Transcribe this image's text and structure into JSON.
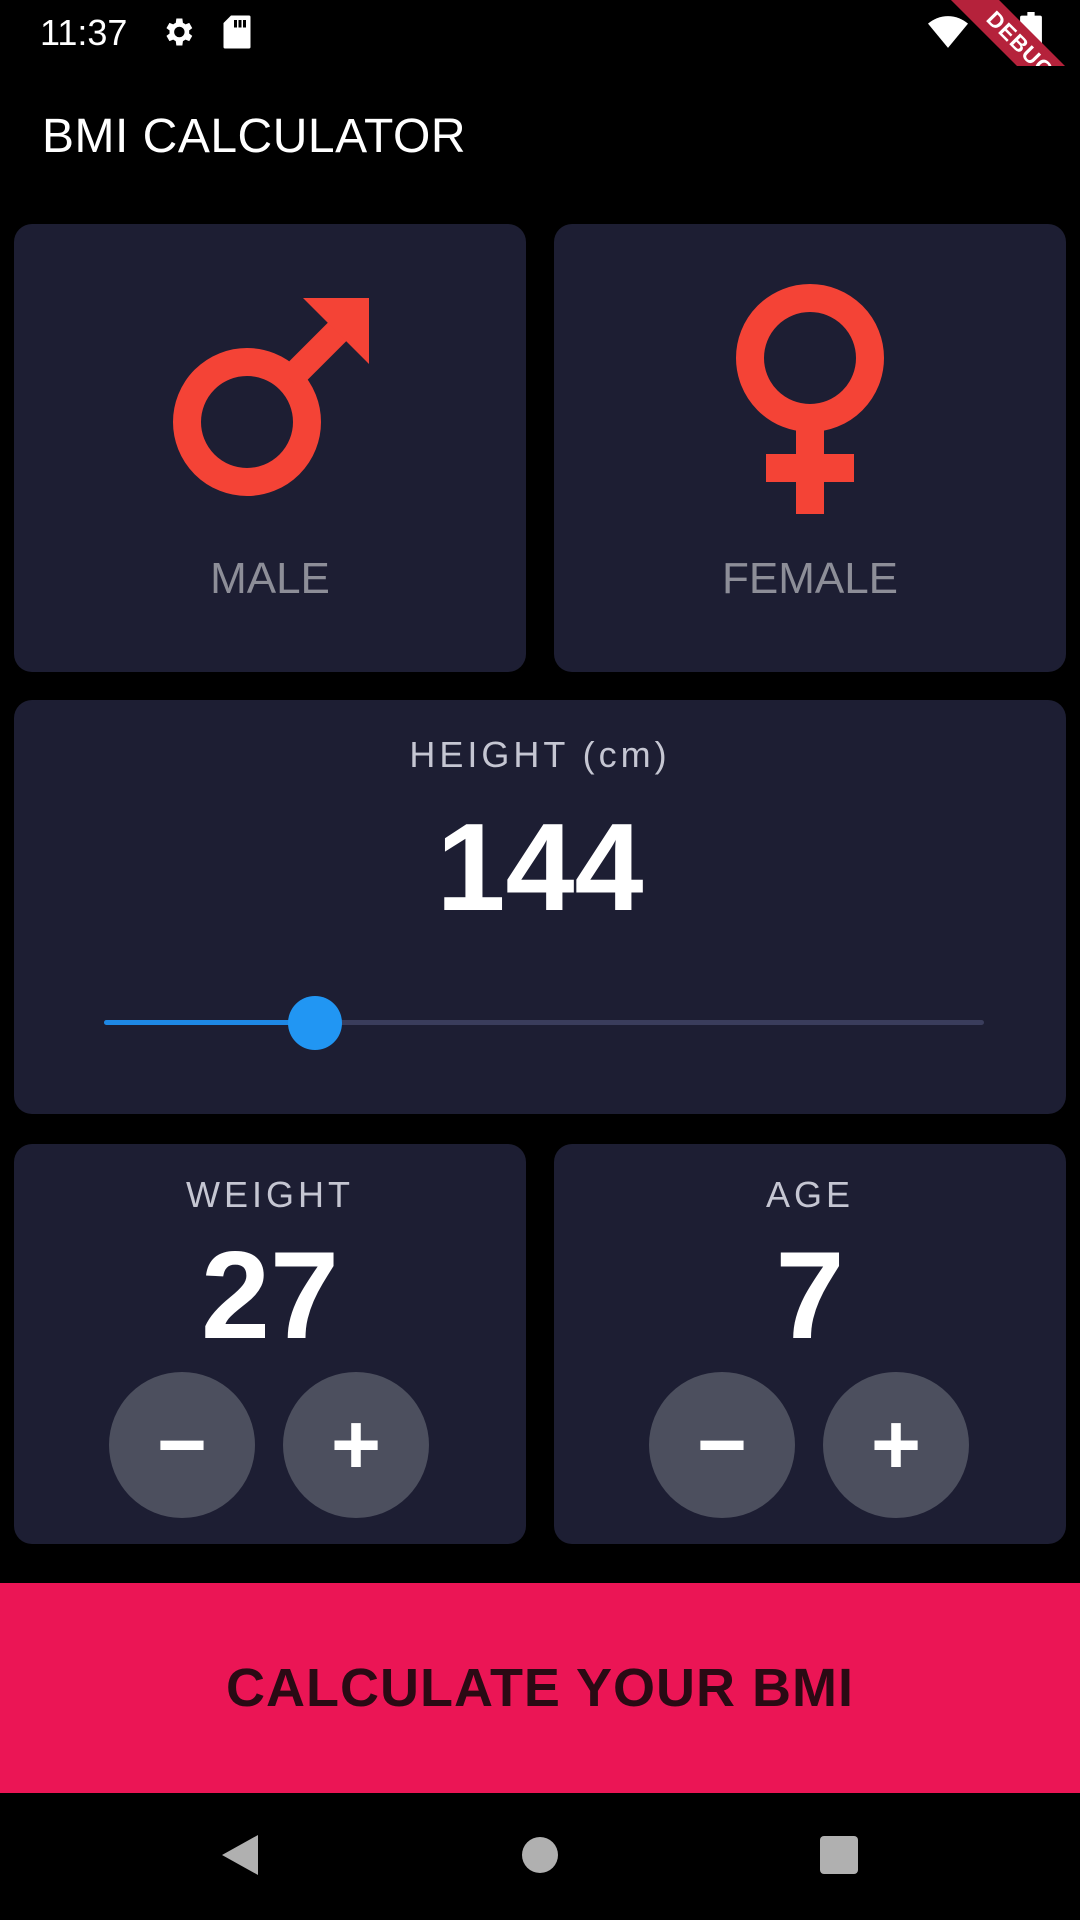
{
  "status_bar": {
    "time": "11:37",
    "icons": [
      "settings-icon",
      "sd-card-icon",
      "wifi-icon",
      "battery-icon"
    ],
    "debug_label": "DEBUG"
  },
  "app_bar": {
    "title": "BMI CALCULATOR"
  },
  "gender": {
    "male_label": "MALE",
    "female_label": "FEMALE",
    "icon_color": "#f44336"
  },
  "height": {
    "label": "HEIGHT (cm)",
    "value": "144",
    "slider_fraction": 0.24,
    "accent": "#2196f3"
  },
  "weight": {
    "label": "WEIGHT",
    "value": "27",
    "minus": "−",
    "plus": "+"
  },
  "age": {
    "label": "AGE",
    "value": "7",
    "minus": "−",
    "plus": "+"
  },
  "cta": {
    "label": "CALCULATE YOUR BMI",
    "color": "#eb1555"
  },
  "nav": {
    "icons": [
      "back-icon",
      "home-icon",
      "recents-icon"
    ]
  }
}
